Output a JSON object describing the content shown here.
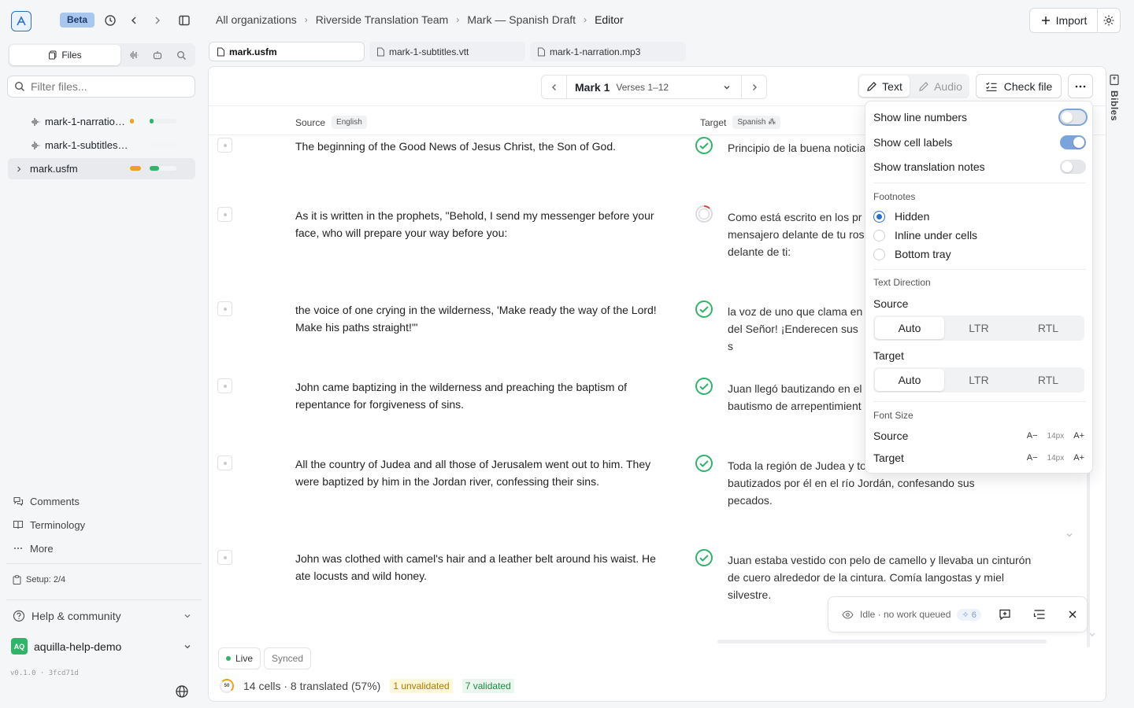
{
  "header": {
    "beta_label": "Beta",
    "breadcrumbs": [
      "All organizations",
      "Riverside Translation Team",
      "Mark — Spanish Draft",
      "Editor"
    ],
    "import_label": "Import"
  },
  "sidebar": {
    "tabs": {
      "files_label": "Files"
    },
    "filter_placeholder": "Filter files...",
    "tree": [
      {
        "label": "mark-1-narratio…",
        "type": "audio"
      },
      {
        "label": "mark-1-subtitles…",
        "type": "audio"
      },
      {
        "label": "mark.usfm",
        "type": "folder"
      }
    ],
    "links": [
      {
        "label": "Comments",
        "icon": "comments-icon"
      },
      {
        "label": "Terminology",
        "icon": "book-icon"
      },
      {
        "label": "More",
        "icon": "more-icon"
      }
    ],
    "setup": "Setup: 2/4",
    "help": "Help & community",
    "org_badge": "AQ",
    "org_name": "aquilla-help-demo",
    "version": "v0.1.0 · 3fcd71d"
  },
  "file_tabs": [
    "mark.usfm",
    "mark-1-subtitles.vtt",
    "mark-1-narration.mp3"
  ],
  "editor": {
    "chapter": "Mark 1",
    "verses": "Verses 1–12",
    "mode_text": "Text",
    "mode_audio": "Audio",
    "check_file": "Check file",
    "source_header": "Source",
    "source_lang": "English",
    "target_header": "Target",
    "target_lang": "Spanish",
    "rows": [
      {
        "source": "The beginning of the Good News of Jesus Christ, the Son of God.",
        "target": "Principio de la buena noticia",
        "status": "validated"
      },
      {
        "source": "As it is written in the prophets, \"Behold, I send my messenger before your face, who will prepare your way before you:",
        "target": "Como está escrito en los pr mensajero delante de tu ros delante de ti:",
        "status": "pending"
      },
      {
        "source": "the voice of one crying in the wilderness, 'Make ready the way of the Lord! Make his paths straight!'\"",
        "target": "la voz de uno que clama en del Señor! ¡Enderecen sus s",
        "status": "validated"
      },
      {
        "source": "John came baptizing in the wilderness and preaching the baptism of repentance for forgiveness of sins.",
        "target": "Juan llegó bautizando en el bautismo de arrepentimient",
        "status": "validated"
      },
      {
        "source": "All the country of Judea and all those of Jerusalem went out to him. They were baptized by him in the Jordan river, confessing their sins.",
        "target": "Toda la región de Judea y to acudían a él. Eran bautizados por él en el río Jordán, confesando sus pecados.",
        "status": "validated"
      },
      {
        "source": "John was clothed with camel's hair and a leather belt around his waist. He ate locusts and wild honey.",
        "target": "Juan estaba vestido con pelo de camello y llevaba un cinturón de cuero alrededor de la cintura. Comía langostas y miel silvestre.",
        "status": "validated"
      }
    ],
    "live_label": "Live",
    "synced_label": "Synced",
    "progress_badge": "50",
    "stats": "14 cells · 8 translated (57%)",
    "unvalidated": "1 unvalidated",
    "validated": "7 validated",
    "idle_text": "Idle · no work queued",
    "idle_count": "6"
  },
  "popover": {
    "show_line_numbers": "Show line numbers",
    "show_cell_labels": "Show cell labels",
    "show_translation_notes": "Show translation notes",
    "toggles": {
      "line_numbers": false,
      "cell_labels": true,
      "translation_notes": false
    },
    "footnotes_heading": "Footnotes",
    "footnote_options": [
      "Hidden",
      "Inline under cells",
      "Bottom tray"
    ],
    "footnote_selected": "Hidden",
    "text_direction_heading": "Text Direction",
    "source_label": "Source",
    "target_label": "Target",
    "direction_options": [
      "Auto",
      "LTR",
      "RTL"
    ],
    "font_size_heading": "Font Size",
    "font_minus": "A−",
    "font_plus": "A+",
    "source_font_size": "14px",
    "target_font_size": "14px"
  },
  "right_rail": {
    "bibles_label": "Bibles"
  },
  "colors": {
    "accent": "#2a6fcf",
    "validated": "#2fb56a",
    "warning": "#f0a020"
  }
}
